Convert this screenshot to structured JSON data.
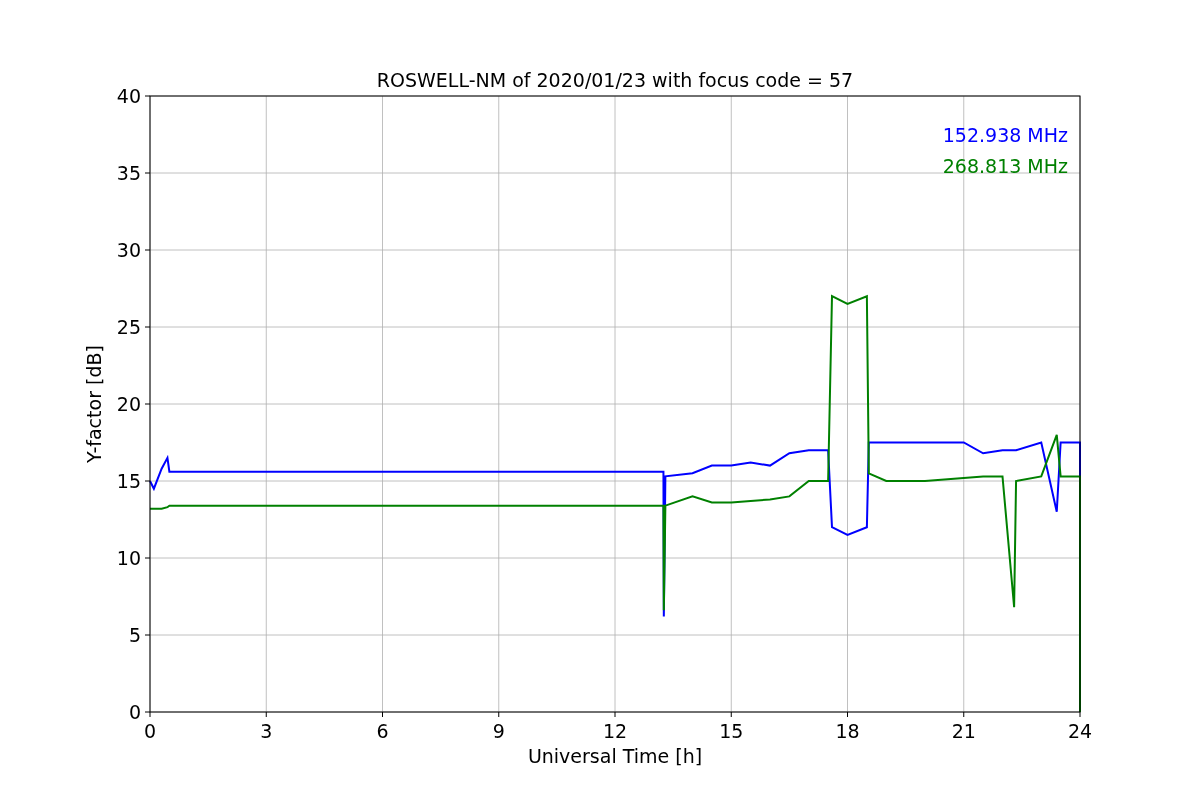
{
  "chart_data": {
    "type": "line",
    "title": "ROSWELL-NM of 2020/01/23 with focus code = 57",
    "xlabel": "Universal Time [h]",
    "ylabel": "Y-factor [dB]",
    "x": [
      0,
      0.1,
      0.3,
      0.45,
      0.5,
      13.25,
      13.26,
      13.3,
      14,
      14.5,
      15,
      15.5,
      16,
      16.5,
      17,
      17.5,
      17.6,
      18,
      18.5,
      18.55,
      19,
      20,
      21,
      21.5,
      22,
      22.3,
      22.35,
      23,
      23.4,
      23.5,
      24,
      24
    ],
    "series": [
      {
        "name": "152.938 MHz",
        "color": "#0000ff",
        "values": [
          15,
          14.5,
          15.8,
          16.5,
          15.6,
          15.6,
          6.2,
          15.3,
          15.5,
          16,
          16,
          16.2,
          16,
          16.8,
          17,
          17,
          12,
          11.5,
          12,
          17.5,
          17.5,
          17.5,
          17.5,
          16.8,
          17,
          17,
          17,
          17.5,
          13,
          17.5,
          17.5,
          0
        ]
      },
      {
        "name": "268.813 MHz",
        "color": "#008000",
        "values": [
          13.2,
          13.2,
          13.2,
          13.3,
          13.4,
          13.4,
          6.6,
          13.4,
          14,
          13.6,
          13.6,
          13.7,
          13.8,
          14,
          15,
          15,
          27,
          26.5,
          27,
          15.5,
          15,
          15,
          15.2,
          15.3,
          15.3,
          6.8,
          15,
          15.3,
          18,
          15.3,
          15.3,
          0
        ]
      }
    ],
    "grid": true,
    "xlim": [
      0,
      24
    ],
    "ylim": [
      0,
      40
    ],
    "xticks": [
      0,
      3,
      6,
      9,
      12,
      15,
      18,
      21,
      24
    ],
    "yticks": [
      0,
      5,
      10,
      15,
      20,
      25,
      30,
      35,
      40
    ]
  }
}
